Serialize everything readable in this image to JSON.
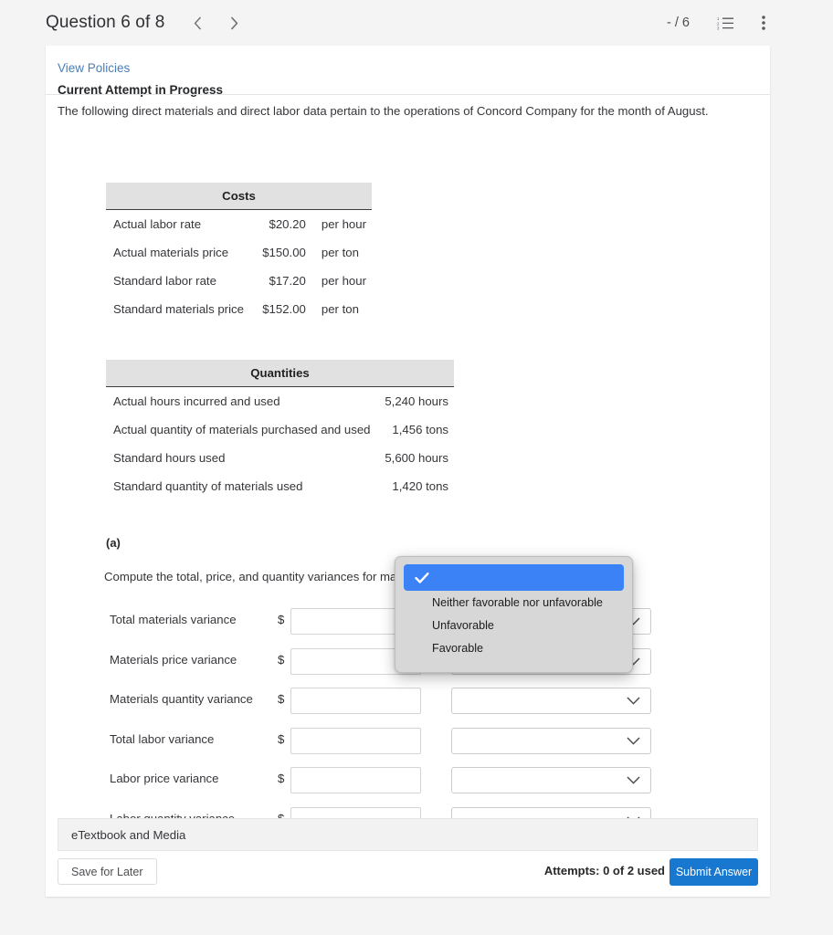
{
  "header": {
    "question_title": "Question 6 of 8",
    "prev_icon": "chevron-left-icon",
    "next_icon": "chevron-right-icon",
    "score": "- / 6",
    "list_icon": "numbered-list-icon",
    "menu_icon": "kebab-menu-icon"
  },
  "card": {
    "view_policies": "View Policies",
    "attempt_status": "Current Attempt in Progress",
    "intro": "The following direct materials and direct labor data pertain to the operations of Concord Company for the month of August."
  },
  "costs_table": {
    "header": "Costs",
    "rows": [
      {
        "label": "Actual labor rate",
        "value": "$20.20",
        "unit": "per hour"
      },
      {
        "label": "Actual materials price",
        "value": "$150.00",
        "unit": "per ton"
      },
      {
        "label": "Standard labor rate",
        "value": "$17.20",
        "unit": "per hour"
      },
      {
        "label": "Standard materials price",
        "value": "$152.00",
        "unit": "per ton"
      }
    ]
  },
  "quantities_table": {
    "header": "Quantities",
    "rows": [
      {
        "label": "Actual hours incurred and used",
        "value": "5,240 hours"
      },
      {
        "label": "Actual quantity of materials purchased and used",
        "value": "1,456 tons"
      },
      {
        "label": "Standard hours used",
        "value": "5,600 hours"
      },
      {
        "label": "Standard quantity of materials used",
        "value": "1,420 tons"
      }
    ]
  },
  "part_a": {
    "label": "(a)",
    "prompt": "Compute the total, price, and quantity variances for materials and labor.",
    "dollar_sign": "$",
    "rows": [
      {
        "label": "Total materials variance",
        "value": "",
        "select_value": "",
        "has_select": true
      },
      {
        "label": "Materials price variance",
        "value": "",
        "select_value": "",
        "has_select": true
      },
      {
        "label": "Materials quantity variance",
        "value": "",
        "select_value": "",
        "has_select": true
      },
      {
        "label": "Total labor variance",
        "value": "",
        "select_value": "",
        "has_select": true
      },
      {
        "label": "Labor price variance",
        "value": "",
        "select_value": "",
        "has_select": true
      },
      {
        "label": "Labor quantity variance",
        "value": "",
        "select_value": "",
        "has_select": true
      }
    ]
  },
  "dropdown": {
    "open": true,
    "check_icon": "checkmark-icon",
    "options": [
      {
        "label": "",
        "selected": true
      },
      {
        "label": "Neither favorable nor unfavorable",
        "selected": false
      },
      {
        "label": "Unfavorable",
        "selected": false
      },
      {
        "label": "Favorable",
        "selected": false
      }
    ]
  },
  "footer": {
    "etextbook_label": "eTextbook and Media",
    "save_label": "Save for Later",
    "attempts_label": "Attempts: 0 of 2 used",
    "submit_label": "Submit Answer"
  },
  "colors": {
    "page_bg": "#f4f4f5",
    "card_bg": "#ffffff",
    "link_blue": "#4a7eb5",
    "accent_blue": "#1878cf",
    "highlight_blue": "#3b82f6",
    "table_header_bg": "#e1e1e1"
  }
}
